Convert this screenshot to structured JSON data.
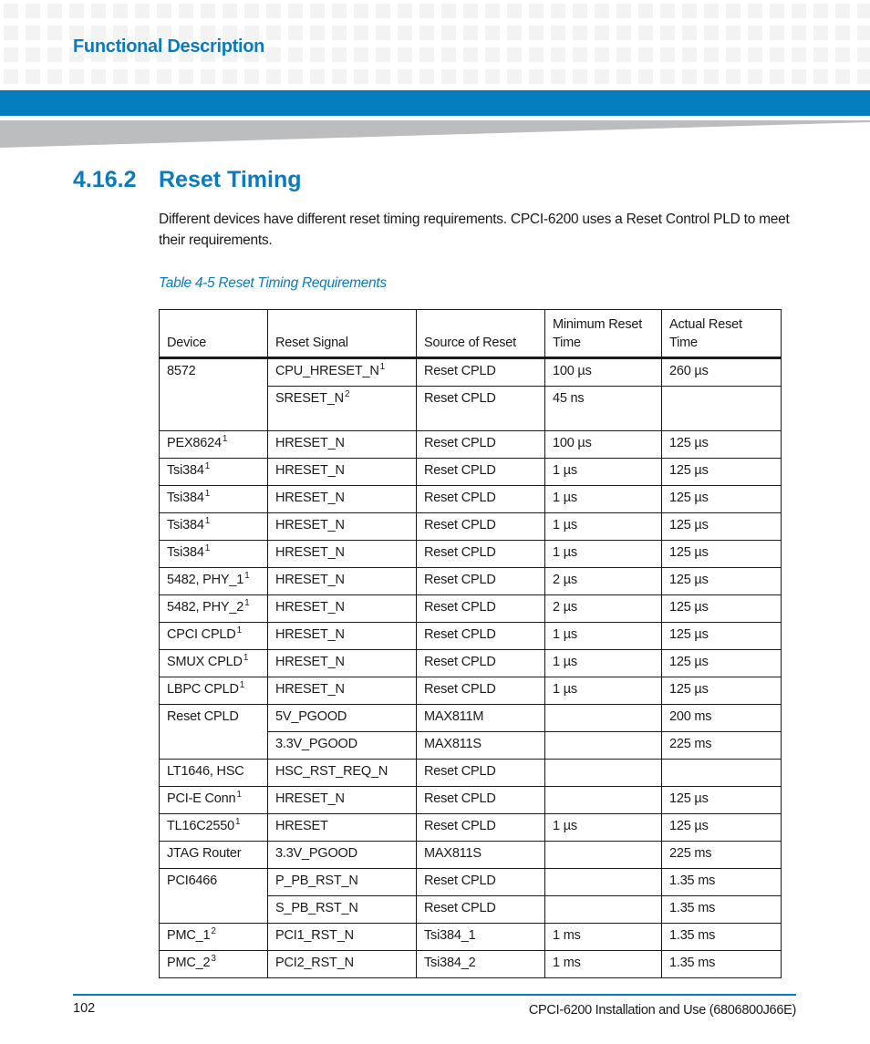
{
  "header": {
    "chapter_title": "Functional Description"
  },
  "section": {
    "number": "4.16.2",
    "title": "Reset Timing",
    "body": "Different devices have different reset timing requirements. CPCI-6200 uses a Reset Control PLD to meet their requirements."
  },
  "table": {
    "caption": "Table 4-5 Reset Timing Requirements",
    "columns": [
      "Device",
      "Reset Signal",
      "Source of Reset",
      "Minimum Reset Time",
      "Actual Reset Time"
    ],
    "rows": [
      {
        "device": "8572",
        "device_sup": "",
        "signal": "CPU_HRESET_N",
        "signal_sup": "1",
        "source": "Reset CPLD",
        "min": "100 µs",
        "actual": "260 µs"
      },
      {
        "device": "",
        "device_sup": "",
        "signal": "SRESET_N",
        "signal_sup": "2",
        "source": "Reset CPLD",
        "min": "45 ns",
        "actual": ""
      },
      {
        "device": "PEX8624",
        "device_sup": "1",
        "signal": "HRESET_N",
        "signal_sup": "",
        "source": "Reset CPLD",
        "min": "100 µs",
        "actual": "125 µs"
      },
      {
        "device": "Tsi384",
        "device_sup": "1",
        "signal": "HRESET_N",
        "signal_sup": "",
        "source": "Reset CPLD",
        "min": "1 µs",
        "actual": "125 µs"
      },
      {
        "device": "Tsi384",
        "device_sup": "1",
        "signal": "HRESET_N",
        "signal_sup": "",
        "source": "Reset CPLD",
        "min": "1 µs",
        "actual": "125 µs"
      },
      {
        "device": "Tsi384",
        "device_sup": "1",
        "signal": "HRESET_N",
        "signal_sup": "",
        "source": "Reset CPLD",
        "min": "1 µs",
        "actual": "125 µs"
      },
      {
        "device": "Tsi384",
        "device_sup": "1",
        "signal": "HRESET_N",
        "signal_sup": "",
        "source": "Reset CPLD",
        "min": "1 µs",
        "actual": "125 µs"
      },
      {
        "device": "5482, PHY_1",
        "device_sup": "1",
        "signal": "HRESET_N",
        "signal_sup": "",
        "source": "Reset CPLD",
        "min": "2 µs",
        "actual": "125 µs"
      },
      {
        "device": "5482, PHY_2",
        "device_sup": "1",
        "signal": "HRESET_N",
        "signal_sup": "",
        "source": "Reset CPLD",
        "min": "2 µs",
        "actual": "125 µs"
      },
      {
        "device": "CPCI CPLD",
        "device_sup": "1",
        "signal": "HRESET_N",
        "signal_sup": "",
        "source": "Reset CPLD",
        "min": "1 µs",
        "actual": "125 µs"
      },
      {
        "device": "SMUX CPLD",
        "device_sup": "1",
        "signal": "HRESET_N",
        "signal_sup": "",
        "source": "Reset CPLD",
        "min": "1 µs",
        "actual": "125 µs"
      },
      {
        "device": "LBPC CPLD",
        "device_sup": "1",
        "signal": "HRESET_N",
        "signal_sup": "",
        "source": "Reset CPLD",
        "min": "1 µs",
        "actual": "125 µs"
      },
      {
        "device": "Reset CPLD",
        "device_sup": "",
        "signal": "5V_PGOOD",
        "signal_sup": "",
        "source": "MAX811M",
        "min": "",
        "actual": "200 ms"
      },
      {
        "device": "",
        "device_sup": "",
        "signal": "3.3V_PGOOD",
        "signal_sup": "",
        "source": "MAX811S",
        "min": "",
        "actual": "225 ms"
      },
      {
        "device": "LT1646, HSC",
        "device_sup": "",
        "signal": "HSC_RST_REQ_N",
        "signal_sup": "",
        "source": "Reset CPLD",
        "min": "",
        "actual": ""
      },
      {
        "device": "PCI-E Conn",
        "device_sup": "1",
        "signal": "HRESET_N",
        "signal_sup": "",
        "source": "Reset CPLD",
        "min": "",
        "actual": "125 µs"
      },
      {
        "device": "TL16C2550",
        "device_sup": "1",
        "signal": "HRESET",
        "signal_sup": "",
        "source": "Reset CPLD",
        "min": "1 µs",
        "actual": "125 µs"
      },
      {
        "device": "JTAG Router",
        "device_sup": "",
        "signal": "3.3V_PGOOD",
        "signal_sup": "",
        "source": "MAX811S",
        "min": "",
        "actual": "225 ms"
      },
      {
        "device": "PCI6466",
        "device_sup": "",
        "signal": "P_PB_RST_N",
        "signal_sup": "",
        "source": "Reset CPLD",
        "min": "",
        "actual": "1.35 ms"
      },
      {
        "device": "",
        "device_sup": "",
        "signal": "S_PB_RST_N",
        "signal_sup": "",
        "source": "Reset CPLD",
        "min": "",
        "actual": "1.35 ms"
      },
      {
        "device": "PMC_1",
        "device_sup": "2",
        "signal": "PCI1_RST_N",
        "signal_sup": "",
        "source": "Tsi384_1",
        "min": "1 ms",
        "actual": "1.35 ms"
      },
      {
        "device": "PMC_2",
        "device_sup": "3",
        "signal": "PCI2_RST_N",
        "signal_sup": "",
        "source": "Tsi384_2",
        "min": "1 ms",
        "actual": "1.35 ms"
      }
    ]
  },
  "footer": {
    "page_number": "102",
    "doc_title": "CPCI-6200 Installation and Use (6806800J66E)"
  },
  "colors": {
    "brand_blue": "#037dbd",
    "heading_blue": "#0a7bbd",
    "pattern_gray": "#f3f3f3",
    "wedge_gray": "#bcbdbf"
  }
}
